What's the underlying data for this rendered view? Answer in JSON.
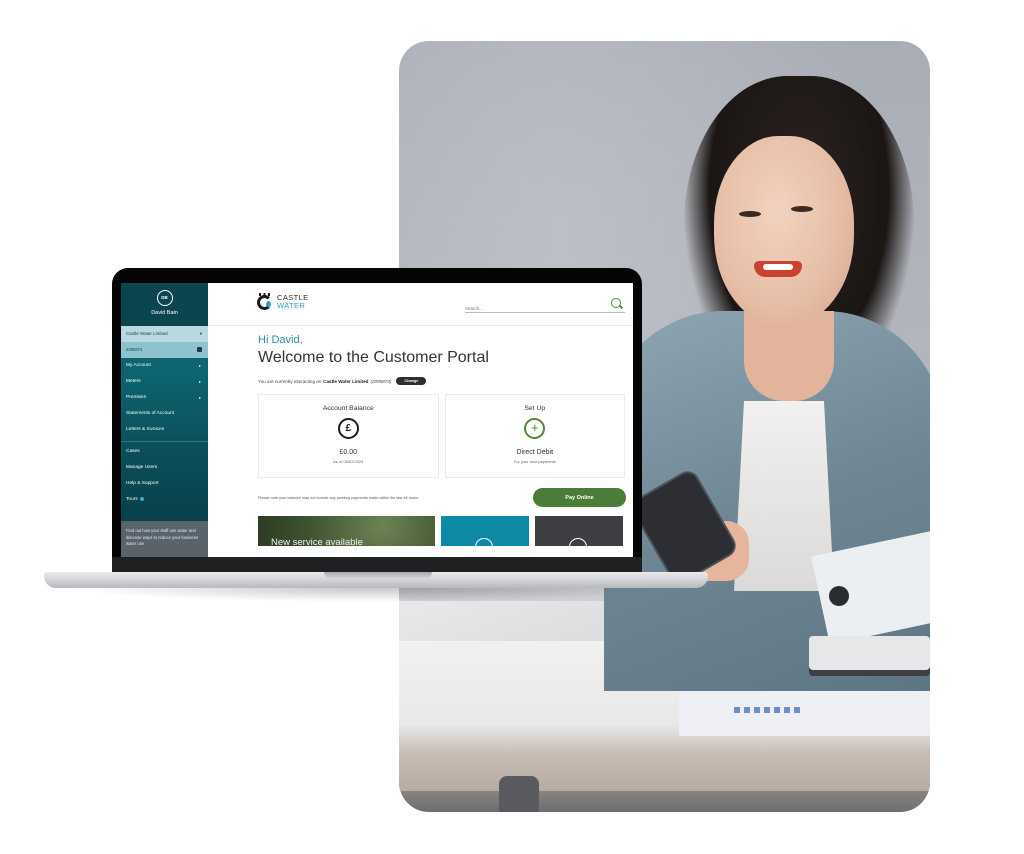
{
  "portal": {
    "sidebar": {
      "profile": {
        "initials": "DB",
        "name": "David Bain"
      },
      "company_select": {
        "value": "Castle Water Limited"
      },
      "account_number": "2095874",
      "items": [
        {
          "label": "My Account",
          "has_submenu": true
        },
        {
          "label": "Meters",
          "has_submenu": true
        },
        {
          "label": "Premises",
          "has_submenu": true
        },
        {
          "label": "Statements of Account",
          "has_submenu": false
        },
        {
          "label": "Letters & Invoices",
          "has_submenu": false
        }
      ],
      "secondary_items": [
        {
          "label": "Cases"
        },
        {
          "label": "Manage Users"
        },
        {
          "label": "Help & Support"
        },
        {
          "label": "Tours"
        }
      ],
      "promo_text": "Find out how your staff use water and discover ways to reduce your business water use"
    },
    "header": {
      "logo": {
        "line1": "CASTLE",
        "line2": "WATER"
      },
      "search": {
        "placeholder": "Search..."
      }
    },
    "greeting": "Hi David,",
    "title": "Welcome to the Customer Portal",
    "interacting": {
      "prefix": "You are currently interacting as",
      "company": "Castle Water Limited",
      "account": "(2095874)",
      "change_label": "Change"
    },
    "cards": {
      "balance": {
        "title": "Account Balance",
        "icon": "pound-icon",
        "value": "£0.00",
        "sub": "As of 06/02/2024"
      },
      "direct_debit": {
        "title": "Set Up",
        "icon": "plus-icon",
        "value": "Direct Debit",
        "sub": "For your next payments"
      }
    },
    "note": "Please note your balance may not include any pending payments made within the last 48 hours.",
    "pay_button": "Pay Online",
    "tiles": {
      "promo": "New service available"
    },
    "icons": {
      "pound": "£",
      "plus": "+",
      "arrow": "▸",
      "chevron": "▾"
    },
    "colors": {
      "sidebar": "#0b4f5a",
      "accent_blue": "#2b8cb0",
      "accent_green": "#4c7d36",
      "teal_tile": "#0f8aa6"
    }
  }
}
